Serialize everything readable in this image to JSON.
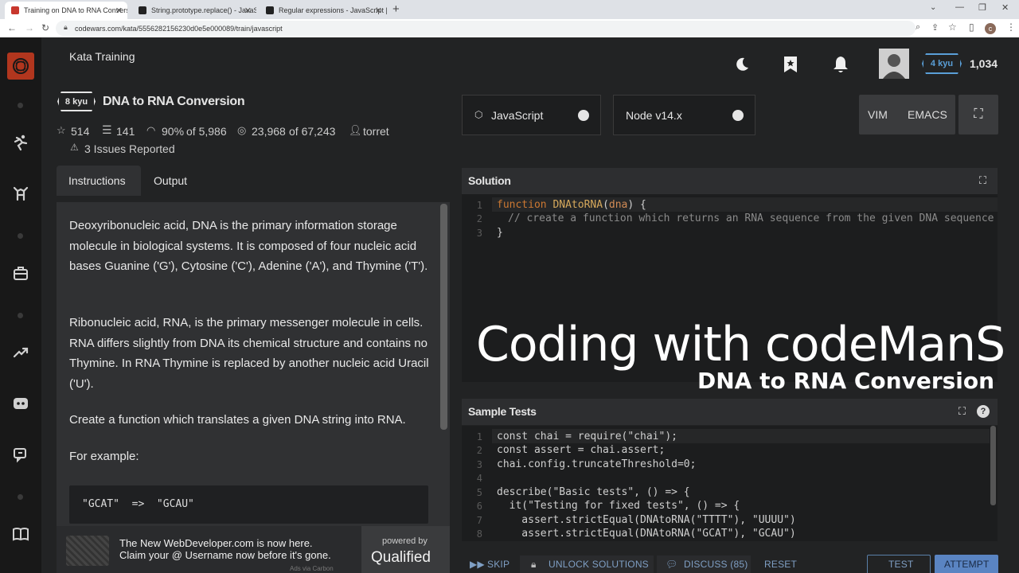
{
  "browser": {
    "tabs": [
      {
        "label": "Training on DNA to RNA Conversi",
        "active": true
      },
      {
        "label": "String.prototype.replace() - JavaS",
        "active": false
      },
      {
        "label": "Regular expressions - JavaScript |",
        "active": false
      }
    ],
    "new_tab": "+",
    "url": "codewars.com/kata/5556282156230d0e5e000089/train/javascript",
    "profile_initial": "c"
  },
  "header": {
    "section_title": "Kata Training",
    "rank_badge": "4 kyu",
    "honor": "1,034"
  },
  "kata": {
    "kyu": "8 kyu",
    "title": "DNA to RNA Conversion",
    "stars": "514",
    "collections": "141",
    "satisfaction_pct": "90%",
    "satisfaction_of": "of 5,986",
    "completed": "23,968",
    "completed_of": "of 67,243",
    "author": "torret",
    "issues": "3 Issues Reported"
  },
  "tabs": {
    "instructions": "Instructions",
    "output": "Output"
  },
  "instructions": {
    "p1": "Deoxyribonucleic acid, DNA is the primary information storage molecule in biological systems. It is composed of four nucleic acid bases Guanine ('G'), Cytosine ('C'), Adenine ('A'), and Thymine ('T').",
    "p2": "Ribonucleic acid, RNA, is the primary messenger molecule in cells. RNA differs slightly from DNA its chemical structure and contains no Thymine. In RNA Thymine is replaced by another nucleic acid Uracil ('U').",
    "p3": "Create a function which translates a given DNA string into RNA.",
    "p4": "For example:",
    "example": "\"GCAT\"  =>  \"GCAU\""
  },
  "ad": {
    "line1": "The New WebDeveloper.com is now here.",
    "line2": "Claim your @ Username now before it's gone.",
    "powered_by": "powered by",
    "brand": "Qualified",
    "ads_via": "Ads via Carbon"
  },
  "editor_toolbar": {
    "language": "JavaScript",
    "runtime": "Node v14.x",
    "vim": "VIM",
    "emacs": "EMACS"
  },
  "solution": {
    "title": "Solution",
    "lines": [
      "1",
      "2",
      "3"
    ],
    "line1_kw": "function",
    "line1_fn": "DNAtoRNA",
    "line1_param": "dna",
    "line2_comment": "// create a function which returns an RNA sequence from the given DNA sequence",
    "line3": "}"
  },
  "overlay": {
    "title": "Coding with codeManS",
    "subtitle": "DNA to RNA Conversion"
  },
  "sample_tests": {
    "title": "Sample Tests",
    "line_numbers": [
      "1",
      "2",
      "3",
      "4",
      "5",
      "6",
      "7",
      "8"
    ],
    "l1": "const chai = require(\"chai\");",
    "l2": "const assert = chai.assert;",
    "l3": "chai.config.truncateThreshold=0;",
    "l5": "describe(\"Basic tests\", () => {",
    "l6": "  it(\"Testing for fixed tests\", () => {",
    "l7": "    assert.strictEqual(DNAtoRNA(\"TTTT\"), \"UUUU\")",
    "l8": "    assert.strictEqual(DNAtoRNA(\"GCAT\"), \"GCAU\")"
  },
  "bottom_actions": {
    "skip": "SKIP",
    "unlock": "UNLOCK SOLUTIONS",
    "discuss": "DISCUSS (85)",
    "reset": "RESET",
    "test": "TEST",
    "attempt": "ATTEMPT"
  }
}
